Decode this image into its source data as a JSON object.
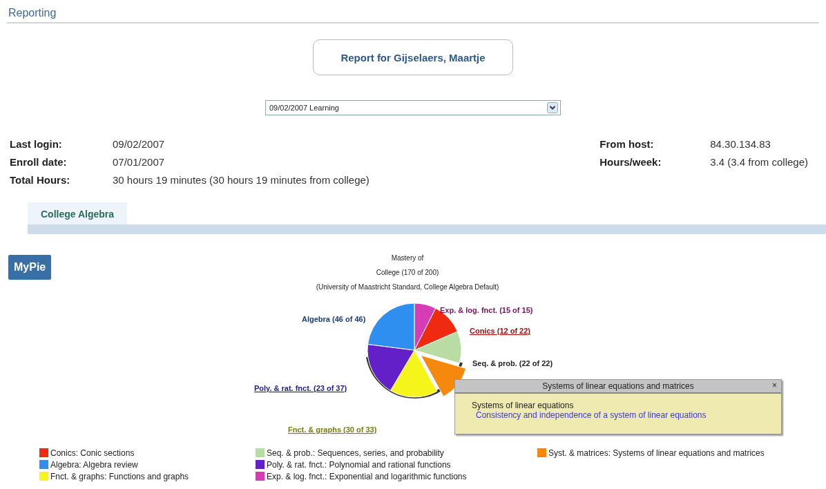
{
  "header": {
    "title": "Reporting"
  },
  "report_title": "Report for Gijselaers, Maartje",
  "session_select": {
    "value": "09/02/2007 Learning"
  },
  "info_left": [
    {
      "label": "Last login:",
      "value": "09/02/2007"
    },
    {
      "label": "Enroll date:",
      "value": "07/01/2007"
    },
    {
      "label": "Total Hours:",
      "value": "30 hours 19 minutes (30 hours 19 minutes from college)"
    }
  ],
  "info_right": [
    {
      "label": "From host:",
      "value": "84.30.134.83"
    },
    {
      "label": "Hours/week:",
      "value": "3.4 (3.4 from college)"
    }
  ],
  "tabs": [
    {
      "label": "College Algebra",
      "selected": true
    }
  ],
  "mypie_button": "MyPie",
  "chart": {
    "title_lines": [
      "Mastery of",
      "College (170 of 200)",
      "(University of Maastricht Standard, College Algebra Default)"
    ],
    "chart_data": {
      "type": "pie",
      "categories": [
        "Exp. & log. fnct.: Exponential and logarithmic functions",
        "Conics: Conic sections",
        "Seq. & prob.: Sequences, series, and probability",
        "Syst. & matrices: Systems of linear equations and matrices",
        "Fnct. & graphs: Functions and graphs",
        "Poly. & rat. fnct.: Polynomial and rational functions",
        "Algebra: Algebra review"
      ],
      "values": [
        7.5,
        11,
        11,
        12.5,
        16.5,
        18.5,
        23
      ]
    },
    "slices": [
      {
        "color": "#d63cb4",
        "exploded": false
      },
      {
        "color": "#f02a10",
        "exploded": false
      },
      {
        "color": "#b9dca4",
        "exploded": false
      },
      {
        "color": "#f5890e",
        "exploded": true
      },
      {
        "color": "#f5f51c",
        "exploded": false
      },
      {
        "color": "#6420c8",
        "exploded": false
      },
      {
        "color": "#2e8ff0",
        "exploded": false
      }
    ],
    "slice_labels": [
      {
        "text": "Exp. & log. fnct. (15 of 15)",
        "color": "#7a1060",
        "link": false
      },
      {
        "text": "Algebra (46 of 46)",
        "color": "#1a3a80",
        "link": false
      },
      {
        "text": "Conics (12 of 22)",
        "color": "#a01010",
        "link": true
      },
      {
        "text": "Seq. & prob. (22 of 22)",
        "color": "#222222",
        "link": false
      },
      {
        "text": "Poly. & rat. fnct. (23 of 37)",
        "color": "#20208a",
        "link": true
      },
      {
        "text": "Fnct. & graphs (30 of 33)",
        "color": "#7a7a10",
        "link": true
      }
    ],
    "tooltip": {
      "title": "Systems of linear equations and matrices",
      "close": "×",
      "heading": "Systems of linear equations",
      "link": "Consistency and independence of a system of linear equations"
    }
  }
}
